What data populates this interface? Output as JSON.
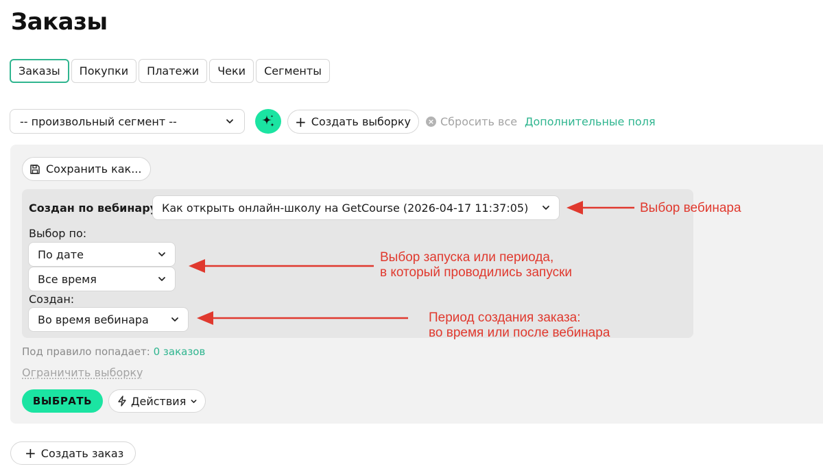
{
  "page": {
    "title": "Заказы"
  },
  "tabs": [
    {
      "label": "Заказы",
      "active": true
    },
    {
      "label": "Покупки",
      "active": false
    },
    {
      "label": "Платежи",
      "active": false
    },
    {
      "label": "Чеки",
      "active": false
    },
    {
      "label": "Сегменты",
      "active": false
    }
  ],
  "toolbar": {
    "segment_select_value": "-- произвольный сегмент --",
    "create_selection_label": "Создать выборку",
    "reset_all_label": "Сбросить все",
    "extra_fields_label": "Дополнительные поля"
  },
  "filter": {
    "save_as_label": "Сохранить как...",
    "webinar_label": "Создан по вебинару",
    "webinar_value": "Как открыть онлайн-школу на GetCourse (2026-04-17 11:37:05)",
    "choose_by_label": "Выбор по:",
    "choose_by_value": "По дате",
    "period_value": "Все время",
    "created_label": "Создан:",
    "created_value": "Во время вебинара"
  },
  "annotations": {
    "webinar": "Выбор вебинара",
    "launch_line1": "Выбор запуска или периода,",
    "launch_line2": "в который проводились запуски",
    "period_line1": "Период создания заказа:",
    "period_line2": "во время или после вебинара",
    "color": "#e0392e"
  },
  "result": {
    "match_label": "Под правило попадает:",
    "match_count": "0 заказов",
    "limit_label": "Ограничить выборку"
  },
  "actions": {
    "select_label": "ВЫБРАТЬ",
    "actions_label": "Действия",
    "create_order_label": "Создать заказ"
  },
  "colors": {
    "accent": "#1be4a2",
    "link_green": "#2fb58f",
    "panel_bg": "#f2f2f2",
    "rule_bg": "#e6e6e6"
  },
  "icons": {
    "ai": "sparkle-icon",
    "save": "floppy-disk-icon",
    "actions": "lightning-icon",
    "reset": "close-circle-icon",
    "select": "chevron-down-icon"
  }
}
